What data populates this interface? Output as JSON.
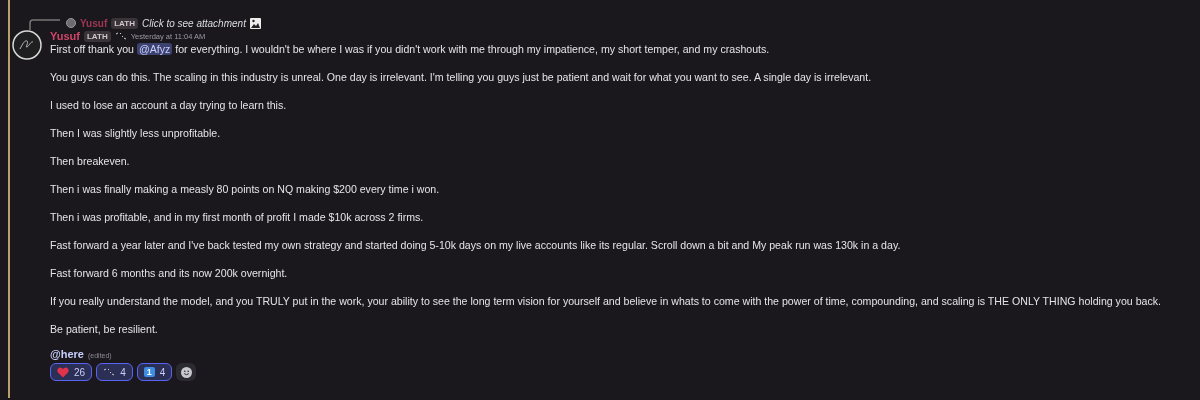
{
  "reply": {
    "author": "Yusuf",
    "tag": "LATH",
    "text": "Click to see attachment"
  },
  "message": {
    "author": "Yusuf",
    "tag": "LATH",
    "timestamp": "Yesterday at 11:04 AM",
    "paragraphs": [
      {
        "segments": [
          {
            "kind": "text",
            "text": "First off thank you "
          },
          {
            "kind": "mention",
            "text": "@Afyz"
          },
          {
            "kind": "text",
            "text": " for everything. I wouldn't be where I was if you didn't work with me through my impatience, my short temper, and my crashouts."
          }
        ]
      },
      {
        "segments": [
          {
            "kind": "text",
            "text": "You guys can do this. The scaling in this industry is unreal. One day is irrelevant. I'm telling you guys just be patient and wait for what you want to see. A single day is irrelevant."
          }
        ]
      },
      {
        "segments": [
          {
            "kind": "text",
            "text": "I used to lose an account a day trying to learn this."
          }
        ]
      },
      {
        "segments": [
          {
            "kind": "text",
            "text": "Then I was slightly less unprofitable."
          }
        ]
      },
      {
        "segments": [
          {
            "kind": "text",
            "text": "Then breakeven."
          }
        ]
      },
      {
        "segments": [
          {
            "kind": "text",
            "text": "Then i was finally making a measly 80 points on NQ making $200 every time i won."
          }
        ]
      },
      {
        "segments": [
          {
            "kind": "text",
            "text": "Then i was profitable, and in my first month of profit I made $10k across 2 firms."
          }
        ]
      },
      {
        "segments": [
          {
            "kind": "text",
            "text": "Fast forward a year later and I've back tested my own strategy and started doing 5-10k days on my live accounts like its regular. Scroll down a bit and My peak run was 130k in a day."
          }
        ]
      },
      {
        "segments": [
          {
            "kind": "text",
            "text": "Fast forward 6 months and its now 200k overnight."
          }
        ]
      },
      {
        "segments": [
          {
            "kind": "text",
            "text": "If you really understand the model, and you TRULY put in the work, your ability to see the long term vision for yourself and believe in whats to come with the power of time, compounding, and scaling is THE ONLY THING holding you back."
          }
        ]
      },
      {
        "segments": [
          {
            "kind": "text",
            "text": "Be patient, be resilient."
          }
        ]
      }
    ],
    "footer_mention": "@here",
    "edited": "(edited)"
  },
  "reactions": [
    {
      "kind": "heart",
      "count": "26",
      "selected": true
    },
    {
      "kind": "sparkle",
      "count": "4",
      "selected": true
    },
    {
      "kind": "keycap",
      "key": "1",
      "count": "4",
      "selected": true
    }
  ]
}
